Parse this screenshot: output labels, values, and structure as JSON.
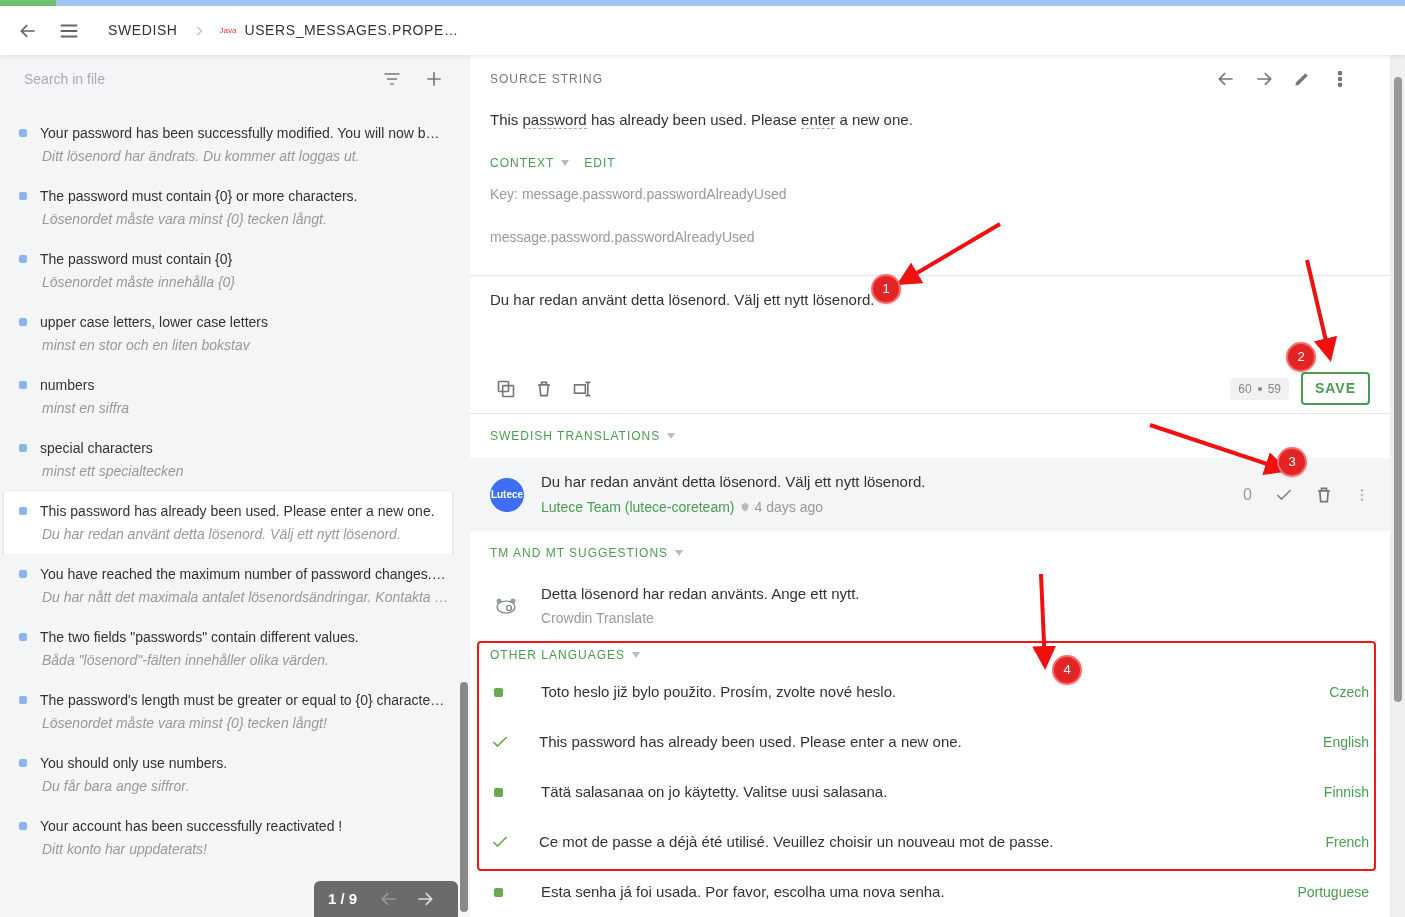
{
  "progress": {
    "level": 0.04
  },
  "header": {
    "crumb": "SWEDISH",
    "file_badge": "Java",
    "file_name": "USERS_MESSAGES.PROPE…"
  },
  "sidebar": {
    "search_placeholder": "Search in file",
    "strings": [
      {
        "source": "Your password has been successfully modified. You will now b…",
        "translation": "Ditt lösenord har ändrats. Du kommer att loggas ut.",
        "selected": false
      },
      {
        "source": "The password must contain {0} or more characters.",
        "translation": "Lösenordet måste vara minst {0} tecken långt.",
        "selected": false
      },
      {
        "source": "The password must contain {0}",
        "translation": "Lösenordet måste innehålla {0}",
        "selected": false
      },
      {
        "source": "upper case letters, lower case letters",
        "translation": "minst en stor och en liten bokstav",
        "selected": false
      },
      {
        "source": "numbers",
        "translation": "minst en siffra",
        "selected": false
      },
      {
        "source": "special characters",
        "translation": "minst ett specialtecken",
        "selected": false
      },
      {
        "source": "This password has already been used. Please enter a new one.",
        "translation": "Du har redan använt detta lösenord. Välj ett nytt lösenord.",
        "selected": true
      },
      {
        "source": "You have reached the maximum number of password changes.…",
        "translation": "Du har nått det maximala antalet lösenordsändringar. Kontakta …",
        "selected": false
      },
      {
        "source": "The two fields \"passwords\" contain different values.",
        "translation": "Båda \"lösenord\"-fälten innehåller olika värden.",
        "selected": false
      },
      {
        "source": "The password's length must be greater or equal to {0} characte…",
        "translation": "Lösenordet måste vara minst {0} tecken långt!",
        "selected": false
      },
      {
        "source": "You should only use numbers.",
        "translation": "Du får bara ange siffror.",
        "selected": false
      },
      {
        "source": "Your account has been successfully reactivated !",
        "translation": "Ditt konto har uppdaterats!",
        "selected": false
      }
    ],
    "pager": "1 / 9"
  },
  "source": {
    "title": "SOURCE STRING",
    "segments": [
      {
        "text": "This ",
        "term": false
      },
      {
        "text": "password",
        "term": true
      },
      {
        "text": " has already been used. Please ",
        "term": false
      },
      {
        "text": "enter",
        "term": true
      },
      {
        "text": " a new one.",
        "term": false
      }
    ],
    "context_label": "CONTEXT",
    "edit_label": "EDIT",
    "key": "Key: message.password.passwordAlreadyUsed",
    "context": "message.password.passwordAlreadyUsed"
  },
  "editor": {
    "value": "Du har redan använt detta lösenord. Välj ett nytt lösenord.",
    "count_source": "60",
    "count_target": "59",
    "save": "SAVE"
  },
  "swedish_translations": {
    "title": "SWEDISH TRANSLATIONS",
    "items": [
      {
        "avatar": "Lutece",
        "text": "Du har redan använt detta lösenord. Välj ett nytt lösenord.",
        "author": "Lutece Team (lutece-coreteam)",
        "time": "4 days ago",
        "votes": "0"
      }
    ]
  },
  "tm_suggestions": {
    "title": "TM AND MT SUGGESTIONS",
    "items": [
      {
        "text": "Detta lösenord har redan använts. Ange ett nytt.",
        "engine": "Crowdin Translate"
      }
    ]
  },
  "other_languages": {
    "title": "OTHER LANGUAGES",
    "items": [
      {
        "kind": "translated",
        "text": "Toto heslo již bylo použito. Prosím, zvolte nové heslo.",
        "language": "Czech"
      },
      {
        "kind": "approved",
        "text": "This password has already been used. Please enter a new one.",
        "language": "English"
      },
      {
        "kind": "translated",
        "text": "Tätä salasanaa on jo käytetty. Valitse uusi salasana.",
        "language": "Finnish"
      },
      {
        "kind": "approved",
        "text": "Ce mot de passe a déjà été utilisé. Veuillez choisir un nouveau mot de passe.",
        "language": "French"
      },
      {
        "kind": "translated",
        "text": "Esta senha já foi usada. Por favor, escolha uma nova senha.",
        "language": "Portuguese"
      }
    ]
  },
  "annotations": [
    "1",
    "2",
    "3",
    "4"
  ]
}
